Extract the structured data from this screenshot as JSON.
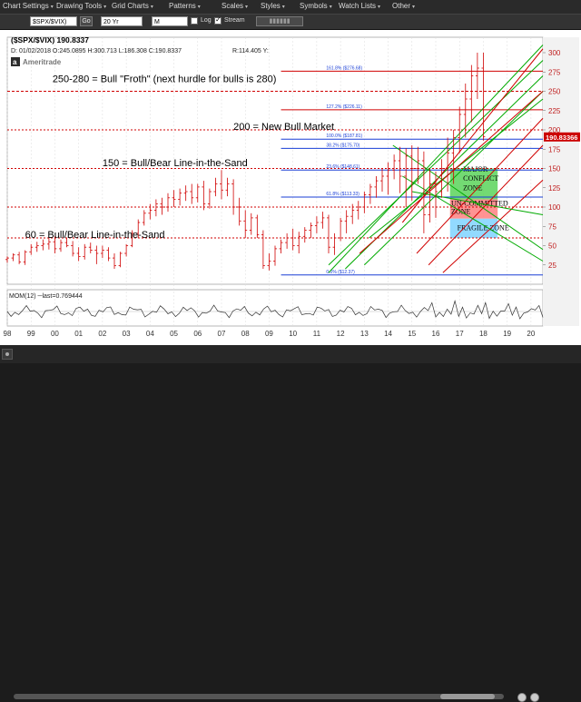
{
  "menu": {
    "items": [
      {
        "label": "Chart Settings"
      },
      {
        "label": "Drawing Tools"
      },
      {
        "label": "Grid Charts"
      },
      {
        "label": "Patterns"
      },
      {
        "label": "Scales"
      },
      {
        "label": "Styles"
      },
      {
        "label": "Symbols"
      },
      {
        "label": "Watch Lists"
      },
      {
        "label": "Other"
      }
    ]
  },
  "toolbar": {
    "symbol": "$SPX/$VIX)",
    "go_label": "Go",
    "period": "20 Yr",
    "frequency": "M",
    "log_label": "Log",
    "stream_label": "Stream",
    "stream_checked": true,
    "log_checked": false
  },
  "chart_header": {
    "symbol_line": "($SPX/$VIX)  190.8337",
    "ohlc_line": "D: 01/02/2018  O:245.0895  H:300.713  L:186.308  C:190.8337",
    "range_line": "R:114.405  Y:",
    "brand": "Ameritrade"
  },
  "chart_data": {
    "type": "bar",
    "series_note": "$SPX/$VIX monthly price bars (not data-labelled)",
    "xaxis_labels": [
      "98",
      "99",
      "00",
      "01",
      "02",
      "03",
      "04",
      "05",
      "06",
      "07",
      "08",
      "09",
      "10",
      "11",
      "12",
      "13",
      "14",
      "15",
      "16",
      "17",
      "18",
      "19",
      "20"
    ],
    "ylim": [
      0,
      320
    ],
    "yaxis_labels": [
      "25",
      "50",
      "75",
      "100",
      "125",
      "150",
      "175",
      "200",
      "225",
      "250",
      "275",
      "300"
    ],
    "last_value_label": "190.83366",
    "last_value": 190.83366,
    "bars": [
      [
        1998.0,
        32,
        36,
        28,
        34
      ],
      [
        1998.25,
        34,
        40,
        30,
        38
      ],
      [
        1998.5,
        38,
        42,
        26,
        29
      ],
      [
        1998.75,
        29,
        44,
        25,
        42
      ],
      [
        1999.0,
        42,
        52,
        38,
        48
      ],
      [
        1999.25,
        48,
        55,
        42,
        50
      ],
      [
        1999.5,
        50,
        58,
        44,
        52
      ],
      [
        1999.75,
        52,
        60,
        45,
        55
      ],
      [
        2000.0,
        55,
        62,
        40,
        46
      ],
      [
        2000.25,
        46,
        58,
        42,
        54
      ],
      [
        2000.5,
        54,
        60,
        48,
        50
      ],
      [
        2000.75,
        50,
        56,
        36,
        40
      ],
      [
        2001.0,
        40,
        48,
        30,
        36
      ],
      [
        2001.25,
        36,
        52,
        32,
        48
      ],
      [
        2001.5,
        48,
        54,
        40,
        44
      ],
      [
        2001.75,
        44,
        50,
        26,
        40
      ],
      [
        2002.0,
        40,
        50,
        34,
        44
      ],
      [
        2002.25,
        44,
        48,
        30,
        34
      ],
      [
        2002.5,
        34,
        40,
        20,
        24
      ],
      [
        2002.75,
        24,
        42,
        22,
        40
      ],
      [
        2003.0,
        40,
        52,
        36,
        50
      ],
      [
        2003.25,
        50,
        70,
        48,
        66
      ],
      [
        2003.5,
        66,
        84,
        60,
        80
      ],
      [
        2003.75,
        80,
        96,
        76,
        92
      ],
      [
        2004.0,
        92,
        104,
        84,
        96
      ],
      [
        2004.25,
        96,
        110,
        88,
        104
      ],
      [
        2004.5,
        104,
        112,
        90,
        100
      ],
      [
        2004.75,
        100,
        118,
        94,
        112
      ],
      [
        2005.0,
        112,
        122,
        100,
        110
      ],
      [
        2005.25,
        110,
        124,
        102,
        118
      ],
      [
        2005.5,
        118,
        128,
        108,
        120
      ],
      [
        2005.75,
        120,
        130,
        104,
        112
      ],
      [
        2006.0,
        112,
        130,
        106,
        126
      ],
      [
        2006.25,
        126,
        134,
        96,
        104
      ],
      [
        2006.5,
        104,
        124,
        98,
        120
      ],
      [
        2006.75,
        120,
        138,
        114,
        130
      ],
      [
        2007.0,
        130,
        148,
        110,
        122
      ],
      [
        2007.25,
        122,
        138,
        114,
        130
      ],
      [
        2007.5,
        130,
        136,
        90,
        100
      ],
      [
        2007.75,
        100,
        112,
        76,
        82
      ],
      [
        2008.0,
        82,
        96,
        60,
        70
      ],
      [
        2008.25,
        70,
        92,
        64,
        86
      ],
      [
        2008.5,
        86,
        90,
        60,
        64
      ],
      [
        2008.75,
        64,
        70,
        20,
        24
      ],
      [
        2009.0,
        24,
        40,
        18,
        30
      ],
      [
        2009.25,
        30,
        50,
        24,
        46
      ],
      [
        2009.5,
        46,
        58,
        40,
        54
      ],
      [
        2009.75,
        54,
        66,
        46,
        60
      ],
      [
        2010.0,
        60,
        72,
        44,
        50
      ],
      [
        2010.25,
        50,
        68,
        40,
        62
      ],
      [
        2010.5,
        62,
        74,
        54,
        70
      ],
      [
        2010.75,
        70,
        80,
        60,
        76
      ],
      [
        2011.0,
        76,
        88,
        66,
        80
      ],
      [
        2011.25,
        80,
        94,
        72,
        86
      ],
      [
        2011.5,
        86,
        90,
        40,
        48
      ],
      [
        2011.75,
        48,
        66,
        38,
        60
      ],
      [
        2012.0,
        60,
        86,
        56,
        82
      ],
      [
        2012.25,
        82,
        96,
        66,
        88
      ],
      [
        2012.5,
        88,
        104,
        78,
        96
      ],
      [
        2012.75,
        96,
        108,
        84,
        100
      ],
      [
        2013.0,
        100,
        120,
        92,
        116
      ],
      [
        2013.25,
        116,
        130,
        104,
        126
      ],
      [
        2013.5,
        126,
        140,
        112,
        134
      ],
      [
        2013.75,
        134,
        150,
        120,
        140
      ],
      [
        2014.0,
        140,
        158,
        116,
        148
      ],
      [
        2014.25,
        148,
        168,
        136,
        160
      ],
      [
        2014.5,
        160,
        178,
        118,
        140
      ],
      [
        2014.75,
        140,
        176,
        100,
        166
      ],
      [
        2015.0,
        166,
        180,
        108,
        150
      ],
      [
        2015.25,
        150,
        178,
        130,
        160
      ],
      [
        2015.5,
        160,
        172,
        66,
        90
      ],
      [
        2015.75,
        90,
        150,
        80,
        130
      ],
      [
        2016.0,
        130,
        146,
        86,
        120
      ],
      [
        2016.25,
        120,
        162,
        112,
        150
      ],
      [
        2016.5,
        150,
        190,
        120,
        170
      ],
      [
        2016.75,
        170,
        200,
        130,
        190
      ],
      [
        2017.0,
        190,
        230,
        170,
        220
      ],
      [
        2017.25,
        220,
        260,
        190,
        240
      ],
      [
        2017.5,
        240,
        284,
        210,
        270
      ],
      [
        2017.75,
        270,
        300,
        240,
        280
      ],
      [
        2018.0,
        280,
        300,
        186,
        191
      ]
    ],
    "fib_labels": [
      {
        "text": "161.8%  ($276.68)",
        "value": 276
      },
      {
        "text": "127.2%  ($226.11)",
        "value": 226
      },
      {
        "text": "100.0%  ($187.81)",
        "value": 188
      },
      {
        "text": "38.2%  ($175.70)",
        "value": 176
      },
      {
        "text": "23.6%  ($148.61)",
        "value": 148
      },
      {
        "text": "61.8%  ($113.33)",
        "value": 113
      },
      {
        "text": "0.0%  ($12.37)",
        "value": 12
      }
    ],
    "annotations": [
      {
        "text": "250-280 = Bull \"Froth\" (next hurdle for bulls is 280)"
      },
      {
        "text": "200 = New Bull Market"
      },
      {
        "text": "150 = Bull/Bear Line-in-the-Sand"
      },
      {
        "text": "60 = Bull/Bear Line-in-the-Sand"
      }
    ],
    "zones": [
      {
        "label": "MAJOR CONFLICT ZONE",
        "color": "#5bd35b",
        "low": 110,
        "high": 150
      },
      {
        "label": "UN-COMMITTED ZONE",
        "color": "#ff8080",
        "low": 85,
        "high": 110
      },
      {
        "label": "FRAGILE ZONE",
        "color": "#7fd4ff",
        "low": 60,
        "high": 85
      }
    ],
    "indicator": {
      "label": "MOM(12) ─last=0.769444"
    },
    "colors": {
      "bars": "#d00000",
      "green_line": "#00aa00",
      "red_line": "#d00000",
      "blue_line": "#1a3fd6",
      "last_value_bg": "#cc0000"
    }
  }
}
